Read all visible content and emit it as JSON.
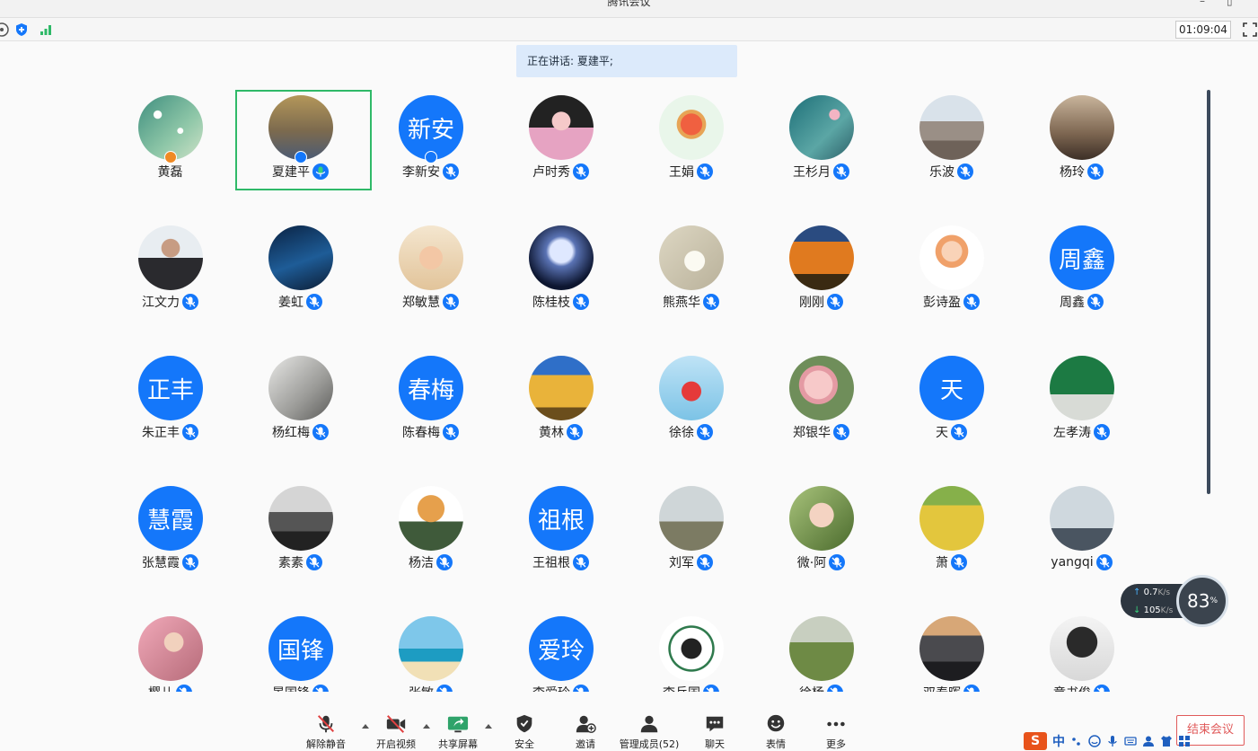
{
  "window": {
    "title": "腾讯会议"
  },
  "status": {
    "timer": "01:09:04"
  },
  "speaking": {
    "text": "正在讲话: 夏建平;"
  },
  "colors": {
    "accent": "#1477fa",
    "selected_border": "#2fb968",
    "end_button": "#e05a5a"
  },
  "participants": [
    {
      "name": "黄磊",
      "avatar": "photo-plum-blossom",
      "host": "orange"
    },
    {
      "name": "夏建平",
      "avatar": "photo-shadow-selfie",
      "host": "blue",
      "speaking": true,
      "selected": true
    },
    {
      "name": "李新安",
      "avatar_text": "新安",
      "host": "blue"
    },
    {
      "name": "卢时秀",
      "avatar": "photo-girl-pink"
    },
    {
      "name": "王娟",
      "avatar": "photo-cartoon-girl"
    },
    {
      "name": "王杉月",
      "avatar": "photo-teal-blossom"
    },
    {
      "name": "乐波",
      "avatar": "photo-man-outdoor"
    },
    {
      "name": "杨玲",
      "avatar": "photo-family"
    },
    {
      "name": "江文力",
      "avatar": "photo-man-suit"
    },
    {
      "name": "姜虹",
      "avatar": "photo-night-road"
    },
    {
      "name": "郑敏慧",
      "avatar": "photo-cartoon-lady"
    },
    {
      "name": "陈桂枝",
      "avatar": "photo-moon"
    },
    {
      "name": "熊燕华",
      "avatar": "photo-sketch-flower"
    },
    {
      "name": "刚刚",
      "avatar": "photo-autumn-trees"
    },
    {
      "name": "彭诗盈",
      "avatar": "photo-cartoon-pink-girl"
    },
    {
      "name": "周鑫",
      "avatar_text": "周鑫"
    },
    {
      "name": "朱正丰",
      "avatar_text": "正丰"
    },
    {
      "name": "杨红梅",
      "avatar": "photo-ink-painting"
    },
    {
      "name": "陈春梅",
      "avatar_text": "春梅"
    },
    {
      "name": "黄林",
      "avatar": "photo-yellow-trees"
    },
    {
      "name": "徐徐",
      "avatar": "photo-heart-hands"
    },
    {
      "name": "郑银华",
      "avatar": "photo-rose"
    },
    {
      "name": "天",
      "avatar_text": "天"
    },
    {
      "name": "左孝涛",
      "avatar": "photo-green-wall"
    },
    {
      "name": "张慧霞",
      "avatar_text": "慧霞"
    },
    {
      "name": "素素",
      "avatar": "photo-bw-room"
    },
    {
      "name": "杨洁",
      "avatar": "photo-cat-suit"
    },
    {
      "name": "王祖根",
      "avatar_text": "祖根"
    },
    {
      "name": "刘军",
      "avatar": "photo-water-tower"
    },
    {
      "name": "微·阿",
      "avatar": "photo-child"
    },
    {
      "name": "萧",
      "avatar": "photo-field-path"
    },
    {
      "name": "yangqi",
      "avatar": "photo-eiffel"
    },
    {
      "name": "樱儿",
      "avatar": "photo-woman-flowers"
    },
    {
      "name": "晏国锋",
      "avatar_text": "国锋"
    },
    {
      "name": "张敏",
      "avatar": "photo-beach"
    },
    {
      "name": "李爱玲",
      "avatar_text": "爱玲"
    },
    {
      "name": "李兵国",
      "avatar": "photo-university-logo"
    },
    {
      "name": "徐杨",
      "avatar": "photo-meadow"
    },
    {
      "name": "双泰晖",
      "avatar": "photo-dusk"
    },
    {
      "name": "章书俊",
      "avatar": "photo-black-hat"
    }
  ],
  "network": {
    "up": "0.7",
    "down": "105",
    "unit": "K/s",
    "score": "83",
    "score_unit": "%"
  },
  "toolbar": {
    "unmute": "解除静音",
    "video": "开启视频",
    "share": "共享屏幕",
    "security": "安全",
    "invite": "邀请",
    "members": "管理成员(52)",
    "chat": "聊天",
    "emoji": "表情",
    "more": "更多",
    "end": "结束会议"
  },
  "ime": {
    "lang": "中"
  }
}
